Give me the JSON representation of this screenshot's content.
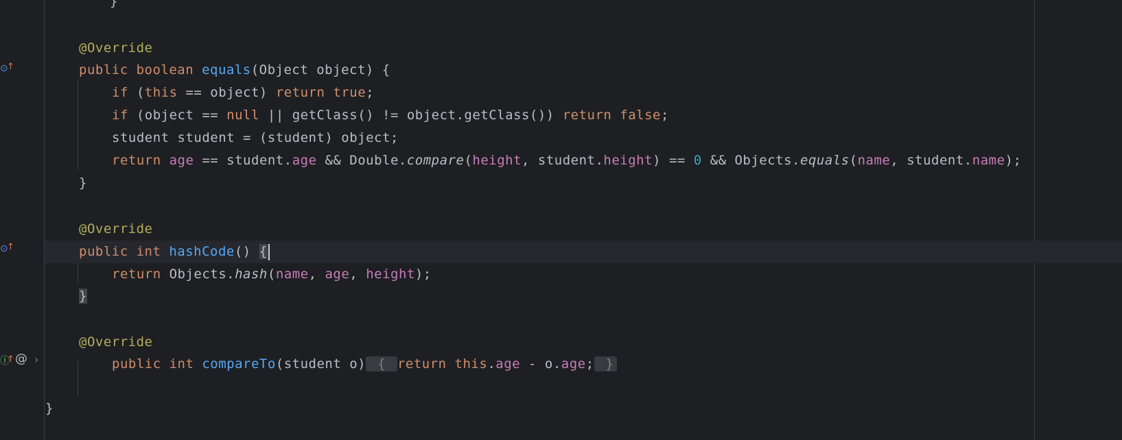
{
  "editor": {
    "lines": [
      {
        "indent": 160,
        "tokens": [
          {
            "t": "}",
            "c": "txt"
          }
        ]
      },
      {
        "indent": 115,
        "tokens": [
          {
            "t": "@Override",
            "c": "ann"
          }
        ]
      },
      {
        "indent": 115,
        "tokens": [
          {
            "t": "public ",
            "c": "kw"
          },
          {
            "t": "boolean ",
            "c": "kw"
          },
          {
            "t": "equals",
            "c": "fn"
          },
          {
            "t": "(Object object) {",
            "c": "txt"
          }
        ]
      },
      {
        "indent": 163,
        "tokens": [
          {
            "t": "if ",
            "c": "kw"
          },
          {
            "t": "(",
            "c": "txt"
          },
          {
            "t": "this",
            "c": "kw"
          },
          {
            "t": " == object) ",
            "c": "txt"
          },
          {
            "t": "return ",
            "c": "kw"
          },
          {
            "t": "true",
            "c": "kw"
          },
          {
            "t": ";",
            "c": "txt"
          }
        ]
      },
      {
        "indent": 163,
        "tokens": [
          {
            "t": "if ",
            "c": "kw"
          },
          {
            "t": "(object == ",
            "c": "txt"
          },
          {
            "t": "null",
            "c": "kw"
          },
          {
            "t": " || getClass() != object.getClass()) ",
            "c": "txt"
          },
          {
            "t": "return ",
            "c": "kw"
          },
          {
            "t": "false",
            "c": "kw"
          },
          {
            "t": ";",
            "c": "txt"
          }
        ]
      },
      {
        "indent": 163,
        "tokens": [
          {
            "t": "student student = (student) object;",
            "c": "txt"
          }
        ]
      },
      {
        "indent": 163,
        "tokens": [
          {
            "t": "return ",
            "c": "kw"
          },
          {
            "t": "age",
            "c": "fld"
          },
          {
            "t": " == student.",
            "c": "txt"
          },
          {
            "t": "age",
            "c": "fld"
          },
          {
            "t": " && Double.",
            "c": "txt"
          },
          {
            "t": "compare",
            "c": "txt it"
          },
          {
            "t": "(",
            "c": "txt"
          },
          {
            "t": "height",
            "c": "fld"
          },
          {
            "t": ", student.",
            "c": "txt"
          },
          {
            "t": "height",
            "c": "fld"
          },
          {
            "t": ") == ",
            "c": "txt"
          },
          {
            "t": "0",
            "c": "num"
          },
          {
            "t": " && Objects.",
            "c": "txt"
          },
          {
            "t": "equals",
            "c": "txt it"
          },
          {
            "t": "(",
            "c": "txt"
          },
          {
            "t": "name",
            "c": "fld"
          },
          {
            "t": ", student.",
            "c": "txt"
          },
          {
            "t": "name",
            "c": "fld"
          },
          {
            "t": ");",
            "c": "txt"
          }
        ]
      },
      {
        "indent": 115,
        "tokens": [
          {
            "t": "}",
            "c": "txt"
          }
        ]
      },
      {
        "indent": 115,
        "tokens": [
          {
            "t": "@Override",
            "c": "ann"
          }
        ]
      },
      {
        "indent": 115,
        "tokens": [
          {
            "t": "public ",
            "c": "kw"
          },
          {
            "t": "int ",
            "c": "kw"
          },
          {
            "t": "hashCode",
            "c": "fn"
          },
          {
            "t": "() ",
            "c": "txt"
          },
          {
            "t": "{",
            "c": "txt hl"
          },
          {
            "t": "",
            "c": "cursor"
          }
        ]
      },
      {
        "indent": 163,
        "tokens": [
          {
            "t": "return ",
            "c": "kw"
          },
          {
            "t": "Objects.",
            "c": "txt"
          },
          {
            "t": "hash",
            "c": "txt it"
          },
          {
            "t": "(",
            "c": "txt"
          },
          {
            "t": "name",
            "c": "fld"
          },
          {
            "t": ", ",
            "c": "txt"
          },
          {
            "t": "age",
            "c": "fld"
          },
          {
            "t": ", ",
            "c": "txt"
          },
          {
            "t": "height",
            "c": "fld"
          },
          {
            "t": ");",
            "c": "txt"
          }
        ]
      },
      {
        "indent": 115,
        "tokens": [
          {
            "t": "}",
            "c": "txt hl"
          }
        ]
      },
      {
        "indent": 115,
        "tokens": [
          {
            "t": "@Override",
            "c": "ann"
          }
        ]
      },
      {
        "indent": 163,
        "tokens": [
          {
            "t": "public ",
            "c": "kw"
          },
          {
            "t": "int ",
            "c": "kw"
          },
          {
            "t": "compareTo",
            "c": "fn"
          },
          {
            "t": "(student o)",
            "c": "txt"
          },
          {
            "t": " { ",
            "c": "fold-chip"
          },
          {
            "t": "return ",
            "c": "kw"
          },
          {
            "t": "this",
            "c": "kw"
          },
          {
            "t": ".",
            "c": "txt"
          },
          {
            "t": "age",
            "c": "fld"
          },
          {
            "t": " - o.",
            "c": "txt"
          },
          {
            "t": "age",
            "c": "fld"
          },
          {
            "t": ";",
            "c": "txt"
          },
          {
            "t": " }",
            "c": "fold-chip"
          }
        ]
      },
      {
        "indent": 66,
        "tokens": [
          {
            "t": "}",
            "c": "txt"
          }
        ]
      }
    ]
  },
  "gutter": {
    "icons": [
      {
        "name": "implements-method-icon",
        "glyph": "⊙",
        "cls": "gi-impl"
      },
      {
        "name": "override-up-arrow-icon",
        "glyph": "↑",
        "cls": "gi-arrow"
      },
      {
        "name": "implements-method-icon",
        "glyph": "⊙",
        "cls": "gi-impl"
      },
      {
        "name": "override-up-arrow-icon",
        "glyph": "↑",
        "cls": "gi-arrow"
      },
      {
        "name": "interface-impl-icon",
        "glyph": "Ⓘ",
        "cls": "gi-i"
      },
      {
        "name": "override-up-arrow-icon",
        "glyph": "↑",
        "cls": "gi-arrow"
      },
      {
        "name": "at-annotation-icon",
        "glyph": "@",
        "cls": "gi-at"
      },
      {
        "name": "fold-chevron-icon",
        "glyph": "›",
        "cls": "gi-chev"
      }
    ]
  }
}
